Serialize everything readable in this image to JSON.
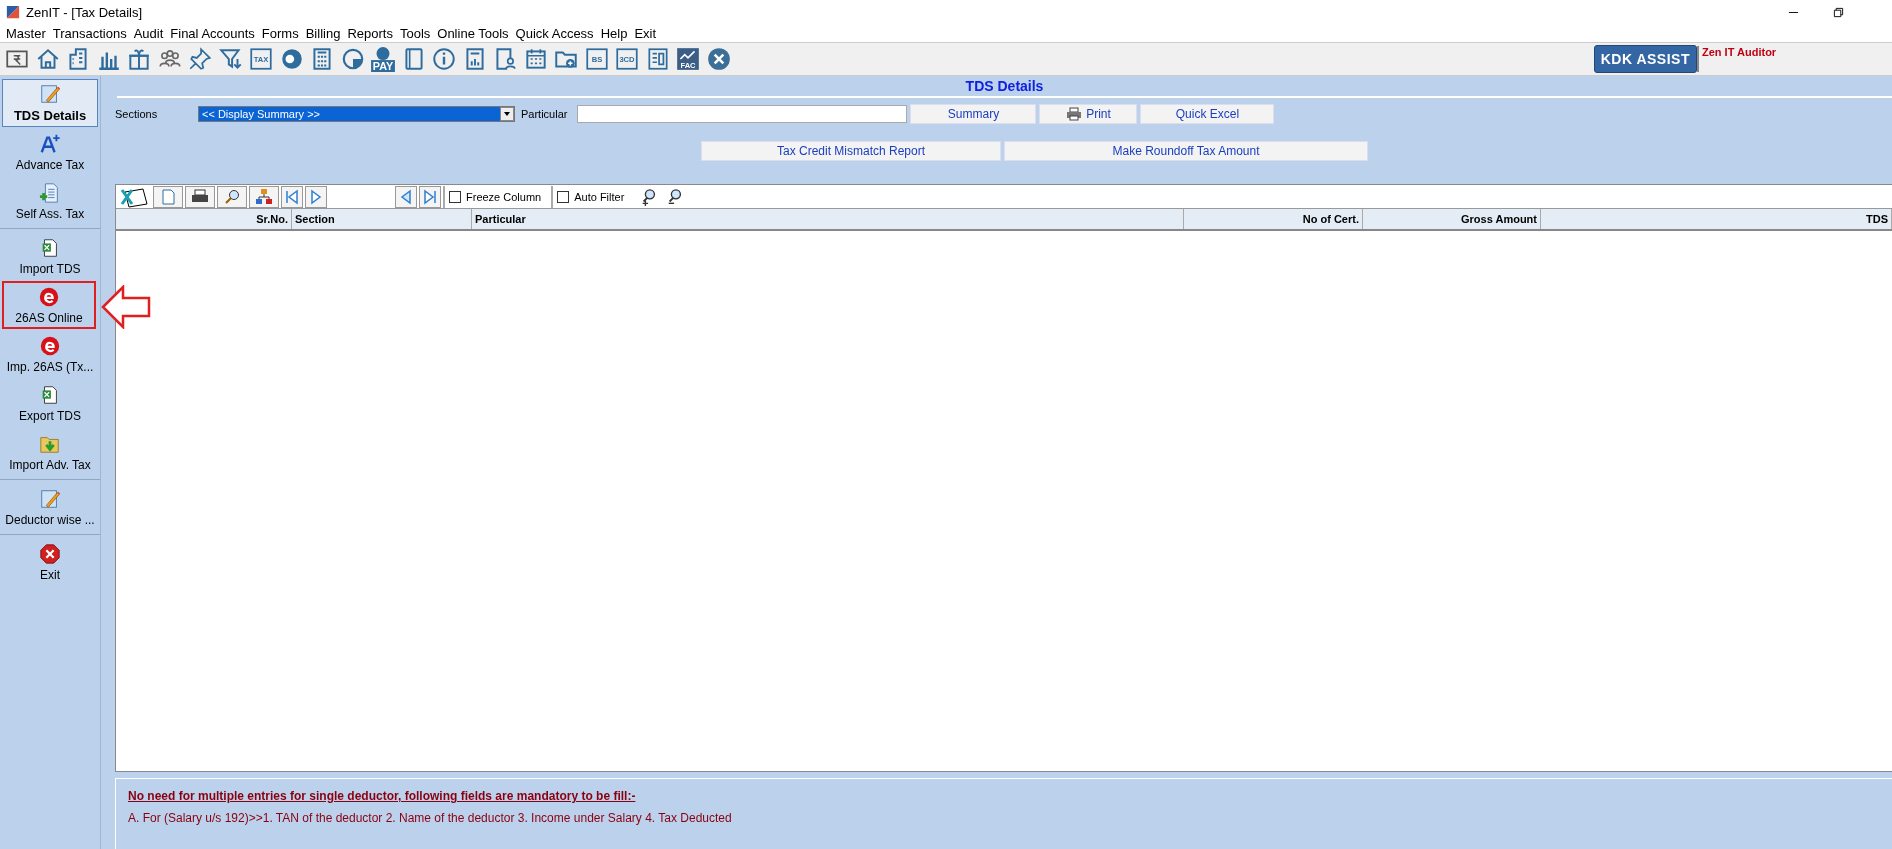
{
  "window": {
    "title": "ZenIT - [Tax Details]"
  },
  "menu": [
    "Master",
    "Transactions",
    "Audit",
    "Final Accounts",
    "Forms",
    "Billing",
    "Reports",
    "Tools",
    "Online Tools",
    "Quick Access",
    "Help",
    "Exit"
  ],
  "toolbar": [
    {
      "kind": "rupee"
    },
    {
      "kind": "home"
    },
    {
      "kind": "building"
    },
    {
      "kind": "chart"
    },
    {
      "kind": "gift"
    },
    {
      "kind": "people"
    },
    {
      "kind": "pin"
    },
    {
      "kind": "filter"
    },
    {
      "kind": "label",
      "label": "TAX"
    },
    {
      "kind": "disc"
    },
    {
      "kind": "calc"
    },
    {
      "kind": "pie"
    },
    {
      "kind": "epay",
      "label": "PAY"
    },
    {
      "kind": "book"
    },
    {
      "kind": "info"
    },
    {
      "kind": "report"
    },
    {
      "kind": "user"
    },
    {
      "kind": "calendar"
    },
    {
      "kind": "folder"
    },
    {
      "kind": "label",
      "label": "BS"
    },
    {
      "kind": "label",
      "label": "3CD"
    },
    {
      "kind": "sheet"
    },
    {
      "kind": "fac",
      "label": "FAC"
    },
    {
      "kind": "close"
    }
  ],
  "assist_button": "KDK ASSIST",
  "product_label": "Zen IT Auditor",
  "sidebar": {
    "groups": [
      {
        "items": [
          {
            "label": "TDS Details",
            "selected": true,
            "highlighted": false
          },
          {
            "label": "Advance Tax",
            "selected": false,
            "highlighted": false
          },
          {
            "label": "Self Ass. Tax",
            "selected": false,
            "highlighted": false
          }
        ]
      },
      {
        "items": [
          {
            "label": "Import TDS",
            "selected": false,
            "highlighted": false
          },
          {
            "label": "26AS Online",
            "selected": false,
            "highlighted": true
          },
          {
            "label": "Imp. 26AS (Tx...",
            "selected": false,
            "highlighted": false
          },
          {
            "label": "Export TDS",
            "selected": false,
            "highlighted": false
          },
          {
            "label": "Import Adv. Tax",
            "selected": false,
            "highlighted": false
          }
        ]
      },
      {
        "items": [
          {
            "label": "Deductor wise ...",
            "selected": false,
            "highlighted": false
          }
        ]
      },
      {
        "items": [
          {
            "label": "Exit",
            "selected": false,
            "highlighted": false
          }
        ]
      }
    ]
  },
  "page_title": "TDS Details",
  "sections_label": "Sections",
  "sections_value": "<< Display Summary >>",
  "particular_label": "Particular",
  "buttons": [
    {
      "label": "Summary",
      "kind": "plain"
    },
    {
      "label": "Print",
      "kind": "print"
    },
    {
      "label": "Quick Excel",
      "kind": "plain"
    }
  ],
  "buttons_row2": [
    "Tax Credit Mismatch Report",
    "Make Roundoff Tax Amount"
  ],
  "grid_toolbar": {
    "freeze_column": {
      "label": "Freeze Column",
      "checked": false
    },
    "auto_filter": {
      "label": "Auto Filter",
      "checked": false
    }
  },
  "table": {
    "columns": [
      {
        "label": "Sr.No."
      },
      {
        "label": "Section"
      },
      {
        "label": "Particular"
      },
      {
        "label": "No of Cert."
      },
      {
        "label": "Gross Amount"
      },
      {
        "label": "TDS"
      }
    ]
  },
  "note": {
    "heading": "No need for multiple entries for single deductor, following fields are mandatory to be fill:-",
    "text": "A. For (Salary u/s 192)>>1. TAN of the deductor 2. Name of the deductor 3. Income under Salary 4. Tax Deducted"
  }
}
